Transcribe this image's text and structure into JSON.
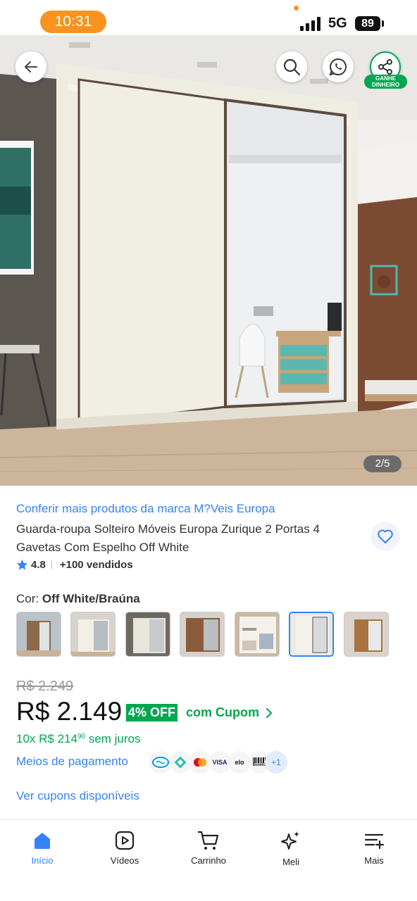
{
  "status_bar": {
    "time": "10:31",
    "network": "5G",
    "battery": "89"
  },
  "gallery": {
    "counter": "2/5",
    "share_badge_line1": "GANHE",
    "share_badge_line2": "DINHEIRO"
  },
  "product": {
    "brand_link": "Conferir mais produtos da marca M?Veis Europa",
    "title": "Guarda-roupa Solteiro Móveis Europa Zurique 2 Portas 4 Gavetas Com Espelho Off White",
    "rating": "4.8",
    "sold": "+100 vendidos",
    "color_label": "Cor:",
    "color_value": "Off White/Braúna",
    "variants_selected_index": 5
  },
  "pricing": {
    "old_price": "R$ 2.249",
    "price": "R$ 2.149",
    "discount_badge": "4% OFF",
    "coupon_link": "com Cupom",
    "installments_prefix": "10x R$ 214",
    "installments_cents": "90",
    "installments_suffix": "sem juros",
    "payment_link": "Meios de pagamento",
    "payment_methods": [
      "Mercado Pago",
      "Pix",
      "Mastercard",
      "VISA",
      "elo",
      "Boleto"
    ],
    "payment_more": "+1",
    "coupons_link": "Ver cupons disponíveis"
  },
  "payment_icon_text": {
    "visa": "VISA",
    "elo": "elo",
    "boleto": "Boleto"
  },
  "bottom_nav": {
    "home": "Início",
    "videos": "Vídeos",
    "cart": "Carrinho",
    "meli": "Meli",
    "more": "Mais"
  },
  "colors": {
    "accent_blue": "#3483fa",
    "green": "#00a650",
    "status_orange": "#f7931e"
  }
}
